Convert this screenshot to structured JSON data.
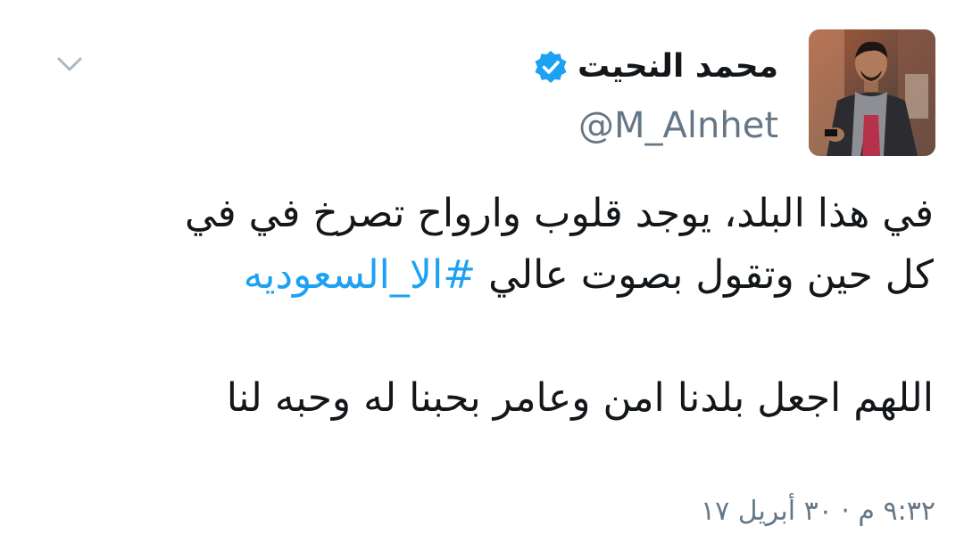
{
  "tweet": {
    "author": {
      "display_name": "محمد النحيت",
      "handle": "@M_Alnhet",
      "verified": true,
      "avatar_icon": "profile-photo"
    },
    "lines": {
      "line1": "في هذا البلد، يوجد قلوب وارواح تصرخ في في",
      "line2_text": "كل حين وتقول بصوت عالي ",
      "line2_hashtag": "#الا_السعوديه",
      "line3": "اللهم اجعل بلدنا امن وعامر بحبنا له وحبه لنا"
    },
    "timestamp": "٩:٣٢ م · ٣٠ أبريل ١٧",
    "icons": {
      "more": "chevron-down-icon",
      "verified": "verified-badge-icon"
    },
    "colors": {
      "hashtag": "#1da1f2",
      "verified_badge": "#1da1f2",
      "muted_text": "#657786"
    }
  }
}
